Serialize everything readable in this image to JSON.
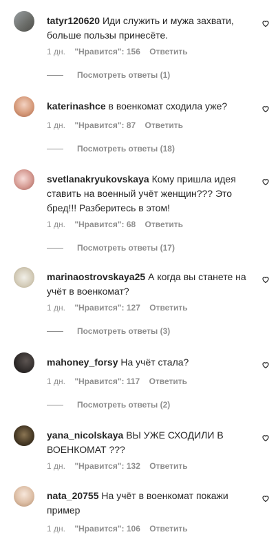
{
  "comments": [
    {
      "user": "tatyr120620",
      "text": "Иди служить и мужа захвати, больше пользы принесёте.",
      "time": "1 дн.",
      "likes": "\"Нравится\": 156",
      "reply": "Ответить",
      "view_replies": "Посмотреть ответы (1)",
      "avatar_colors": [
        "#8a8f92",
        "#5d5f5b"
      ]
    },
    {
      "user": "katerinashce",
      "text": "в военкомат сходила уже?",
      "time": "1 дн.",
      "likes": "\"Нравится\": 87",
      "reply": "Ответить",
      "view_replies": "Посмотреть ответы (18)",
      "avatar_colors": [
        "#e6b9a6",
        "#c9845f"
      ]
    },
    {
      "user": "svetlanakryukovskaya",
      "text": "Кому пришла идея ставить на военный учёт женщин??? Это бред!!! Разберитесь в этом!",
      "time": "1 дн.",
      "likes": "\"Нравится\": 68",
      "reply": "Ответить",
      "view_replies": "Посмотреть ответы (17)",
      "avatar_colors": [
        "#e9c7c4",
        "#b5766f"
      ]
    },
    {
      "user": "marinaostrovskaya25",
      "text": "А когда вы станете на учёт в военкомат?",
      "time": "1 дн.",
      "likes": "\"Нравится\": 127",
      "reply": "Ответить",
      "view_replies": "Посмотреть ответы (3)",
      "avatar_colors": [
        "#e4e1d8",
        "#b9b29e"
      ]
    },
    {
      "user": "mahoney_forsy",
      "text": "На учёт стала?",
      "time": "1 дн.",
      "likes": "\"Нравится\": 117",
      "reply": "Ответить",
      "view_replies": "Посмотреть ответы (2)",
      "avatar_colors": [
        "#3f3b3a",
        "#1f1c1c"
      ]
    },
    {
      "user": "yana_nicolskaya",
      "text": "ВЫ УЖЕ СХОДИЛИ В ВОЕНКОМАТ ???",
      "time": "1 дн.",
      "likes": "\"Нравится\": 132",
      "reply": "Ответить",
      "avatar_colors": [
        "#6b5a43",
        "#2b2418"
      ]
    },
    {
      "user": "nata_20755",
      "text": "На учёт в военкомат покажи пример",
      "time": "1 дн.",
      "likes": "\"Нравится\": 106",
      "reply": "Ответить",
      "avatar_colors": [
        "#efd9c9",
        "#c9a489"
      ]
    }
  ],
  "icons": {
    "avatar": "avatar-photo",
    "like": "heart-outline-icon"
  }
}
